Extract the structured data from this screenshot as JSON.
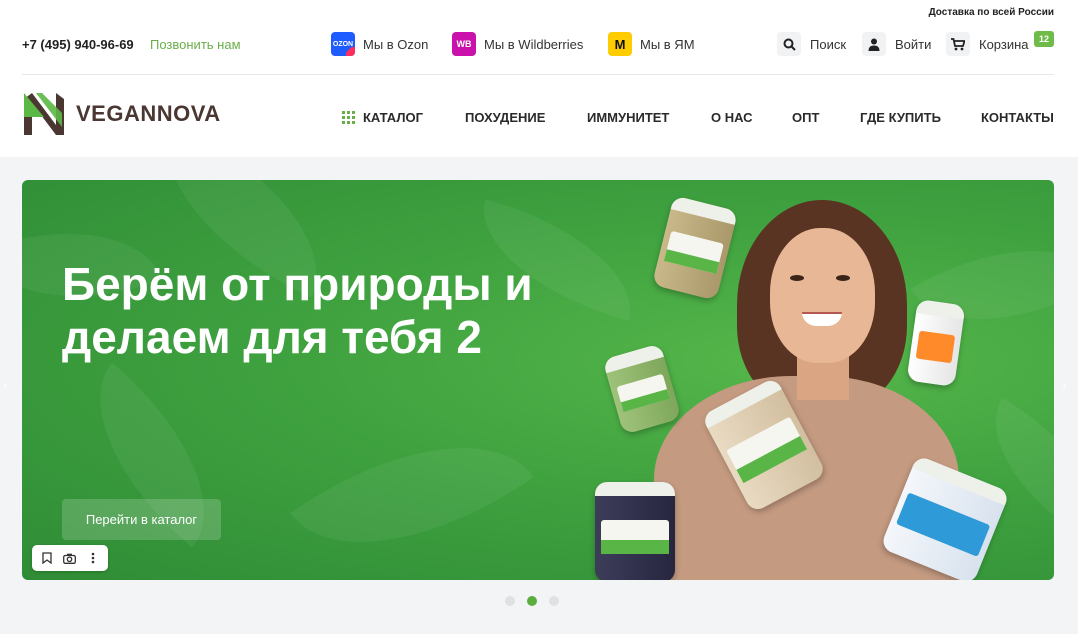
{
  "header": {
    "delivery": "Доставка по всей России",
    "phone": "+7 (495) 940-96-69",
    "callback": "Позвонить нам",
    "marketplaces": {
      "ozon_logo": "OZON",
      "ozon_label": "Мы в Ozon",
      "wb_logo": "WB",
      "wb_label": "Мы в Wildberries",
      "ym_logo": "M",
      "ym_label": "Мы в ЯМ"
    },
    "actions": {
      "search": "Поиск",
      "login": "Войти",
      "cart": "Корзина",
      "cart_count": "12"
    },
    "brand": "VEGANNOVA",
    "nav": {
      "catalog": "КАТАЛОГ",
      "pohudenie": "ПОХУДЕНИЕ",
      "immunitet": "ИММУНИТЕТ",
      "onas": "О НАС",
      "opt": "ОПТ",
      "gde": "ГДЕ КУПИТЬ",
      "kontakty": "КОНТАКТЫ"
    }
  },
  "hero": {
    "title": "Берём от природы и делаем для тебя 2",
    "button": "Перейти в каталог",
    "active_slide": 2,
    "slide_count": 3
  },
  "colors": {
    "accent_green": "#6aae4a",
    "hero_green": "#3fa23f",
    "brand_brown": "#4a3731",
    "ozon": "#1f5cff",
    "wildberries": "#cb11ab",
    "yandex_market": "#ffcc00"
  },
  "icons": {
    "search": "search-icon",
    "login": "user-icon",
    "cart": "cart-icon",
    "catalog": "grid-icon",
    "bookmark": "bookmark-icon",
    "camera": "camera-icon",
    "more": "more-vertical-icon"
  }
}
